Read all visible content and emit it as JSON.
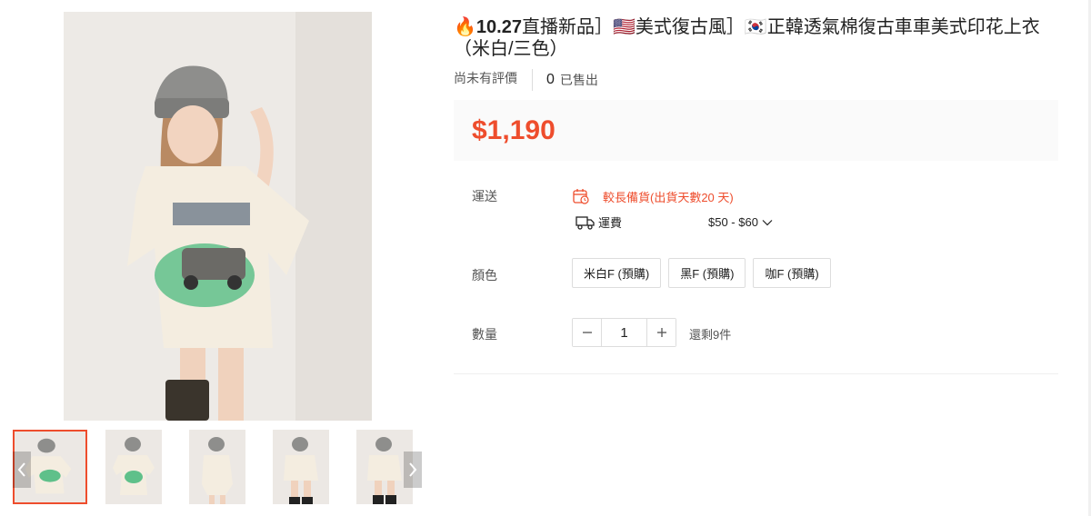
{
  "product": {
    "title_fire": "🔥",
    "title_prefix": "10.27",
    "title_rest": "直播新品］🇺🇸美式復古風］🇰🇷正韓透氣棉復古車車美式印花上衣（米白/三色）",
    "rating_text": "尚未有評價",
    "sold_count": "0",
    "sold_label": "已售出",
    "price": "$1,190"
  },
  "gallery": {
    "main_image_alt": "product-photo",
    "thumbnails": [
      "thumb-1",
      "thumb-2",
      "thumb-3",
      "thumb-4",
      "thumb-5"
    ],
    "active_index": 0
  },
  "shipping": {
    "label": "運送",
    "notice": "較長備貨(出貨天數20 天)",
    "fee_label": "運費",
    "fee_value": "$50 - $60"
  },
  "color": {
    "label": "顏色",
    "options": [
      "米白F (預購)",
      "黑F (預購)",
      "咖F (預購)"
    ]
  },
  "quantity": {
    "label": "數量",
    "value": "1",
    "stock_text": "還剩9件"
  },
  "colors": {
    "accent": "#ee4d2d",
    "price_bg": "#fafafa"
  }
}
